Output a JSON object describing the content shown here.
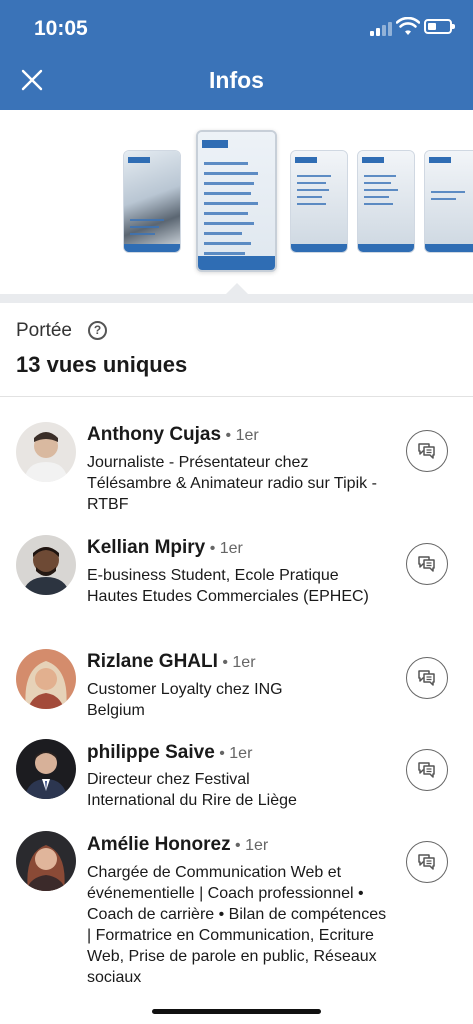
{
  "status_bar": {
    "time": "10:05"
  },
  "header": {
    "title": "Infos"
  },
  "reach": {
    "label": "Portée",
    "count": "13 vues uniques"
  },
  "viewers": [
    {
      "name": "Anthony Cujas",
      "degree": "1er",
      "headline": "Journaliste - Présentateur chez Télésambre & Animateur radio sur Tipik - RTBF",
      "avatar_color": "#cfc8c2"
    },
    {
      "name": "Kellian Mpiry",
      "degree": "1er",
      "headline": "E-business Student, Ecole Pratique Hautes Etudes Commerciales (EPHEC)",
      "avatar_color": "#7a5a45"
    },
    {
      "name": "Rizlane GHALI",
      "degree": "1er",
      "headline": "Customer Loyalty chez ING Belgium",
      "avatar_color": "#c9a27c"
    },
    {
      "name": "philippe Saive",
      "degree": "1er",
      "headline": "Directeur chez Festival International du Rire de Liège",
      "avatar_color": "#2f3440"
    },
    {
      "name": "Amélie Honorez",
      "degree": "1er",
      "headline": "Chargée de Communication Web et événementielle | Coach professionnel • Coach de carrière • Bilan de compétences | Formatrice en Communication, Ecriture Web, Prise de parole en public, Réseaux sociaux",
      "avatar_color": "#8a5a4a"
    }
  ],
  "colors": {
    "header_bg": "#3a73b8",
    "accent": "#2f6db4"
  },
  "icons": {
    "close": "close-icon",
    "help": "help-icon",
    "message": "message-icon"
  }
}
